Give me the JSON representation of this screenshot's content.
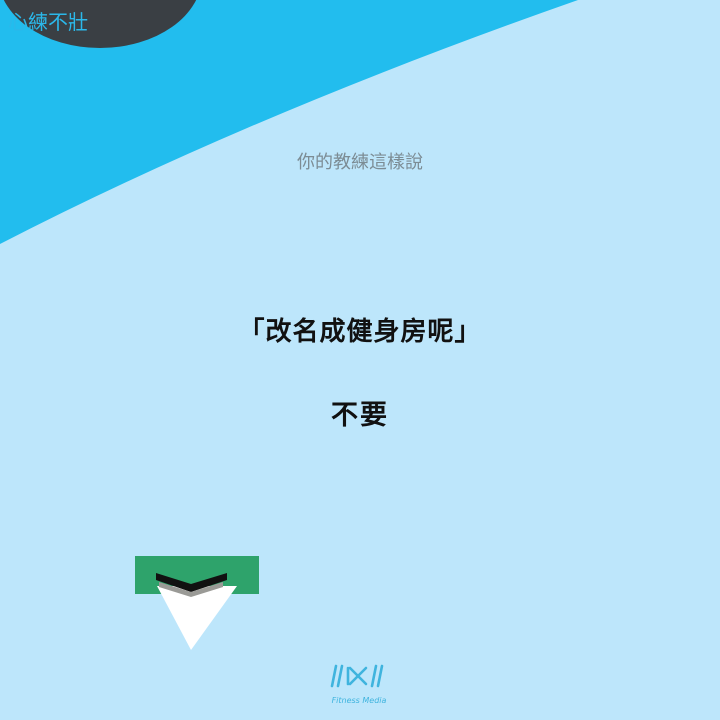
{
  "header": {
    "brand_title": "心練不壯"
  },
  "main": {
    "coach_says": "你的教練這樣說",
    "quote": "「改名成健身房呢」",
    "answer": "不要"
  },
  "footer": {
    "logo_subtitle": "Fitness Media"
  },
  "colors": {
    "background": "#bde6fb",
    "wave": "#22bdee",
    "circle": "#3a3f44",
    "accent_green": "#2ea36b",
    "logo": "#3fb4de"
  },
  "icons": {
    "next": "chevron-down-icon",
    "logo": "logo-icon"
  }
}
